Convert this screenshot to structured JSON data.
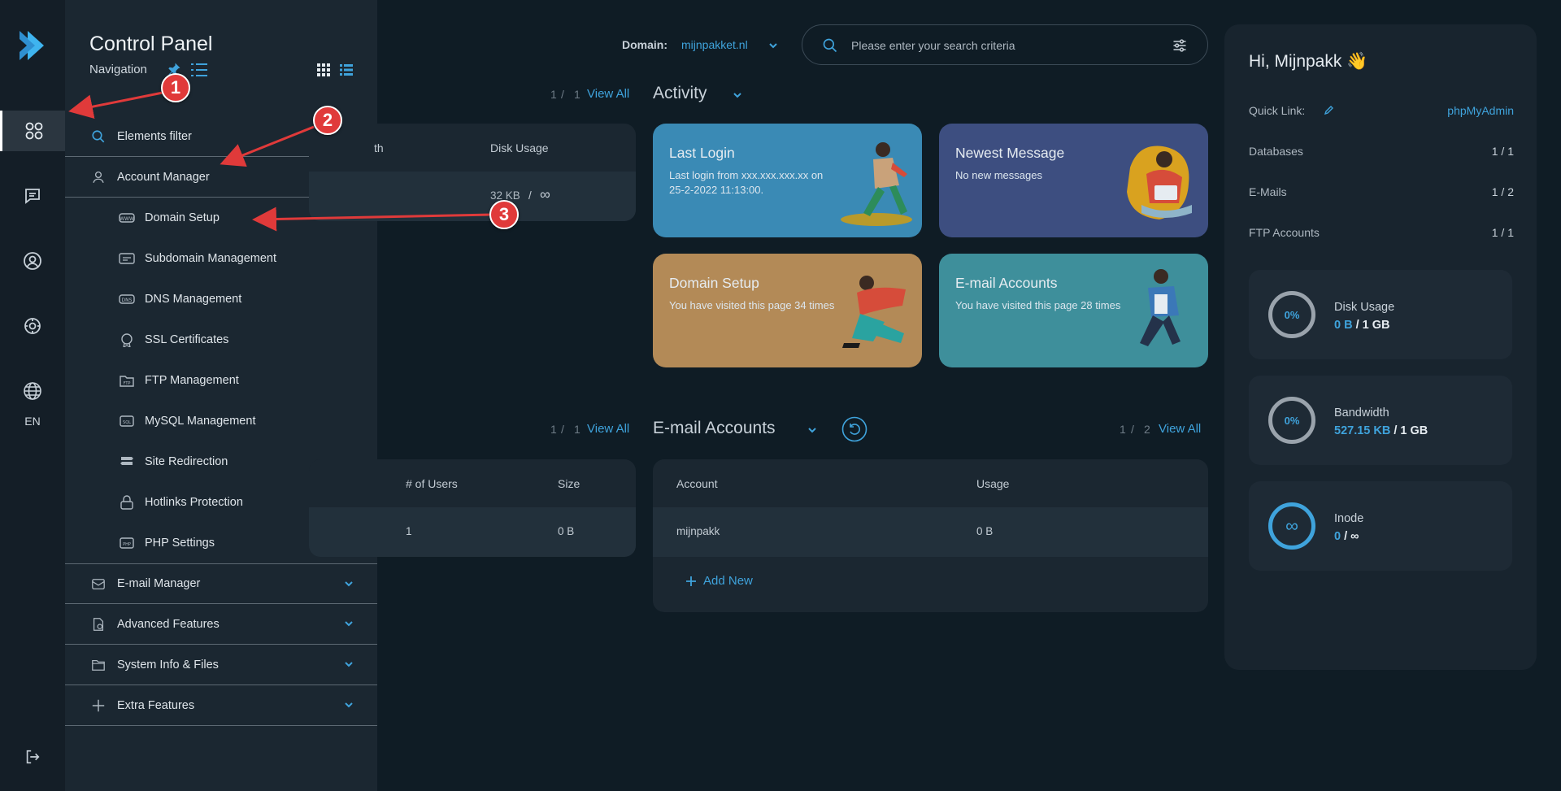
{
  "rail": {
    "lang": "EN"
  },
  "nav": {
    "title": "Control Panel",
    "subtitle": "Navigation",
    "filter_label": "Elements filter",
    "account_manager": "Account Manager",
    "items": [
      {
        "label": "Domain Setup",
        "icon": "www-icon"
      },
      {
        "label": "Subdomain Management",
        "icon": "subdomain-icon"
      },
      {
        "label": "DNS Management",
        "icon": "dns-icon"
      },
      {
        "label": "SSL Certificates",
        "icon": "ssl-icon"
      },
      {
        "label": "FTP Management",
        "icon": "ftp-icon"
      },
      {
        "label": "MySQL Management",
        "icon": "sql-icon"
      },
      {
        "label": "Site Redirection",
        "icon": "signpost-icon"
      },
      {
        "label": "Hotlinks Protection",
        "icon": "lock-icon"
      },
      {
        "label": "PHP Settings",
        "icon": "php-icon"
      }
    ],
    "sections": [
      {
        "label": "E-mail Manager",
        "icon": "mail-icon"
      },
      {
        "label": "Advanced Features",
        "icon": "advanced-icon"
      },
      {
        "label": "System Info & Files",
        "icon": "folder-icon"
      },
      {
        "label": "Extra Features",
        "icon": "plus-icon"
      }
    ]
  },
  "header": {
    "domain_label": "Domain:",
    "domain_value": "mijnpakket.nl",
    "search_placeholder": "Please enter your search criteria"
  },
  "domains_table": {
    "counter_a": "1",
    "sep": "/",
    "counter_b": "1",
    "view_all": "View All",
    "col_partial": "th",
    "col_disk": "Disk Usage",
    "disk_value": "32 KB",
    "disk_sep": "/",
    "disk_limit": "∞"
  },
  "activity": {
    "title": "Activity",
    "cards": [
      {
        "title": "Last Login",
        "text": "Last login from xxx.xxx.xxx.xx on 25-2-2022 11:13:00."
      },
      {
        "title": "Newest Message",
        "text": "No new messages"
      },
      {
        "title": "Domain Setup",
        "text": "You have visited this page 34 times"
      },
      {
        "title": "E-mail Accounts",
        "text": "You have visited this page 28 times"
      }
    ]
  },
  "ftp_table": {
    "counter_a": "1",
    "sep": "/",
    "counter_b": "1",
    "view_all": "View All",
    "col_users": "# of Users",
    "col_size": "Size",
    "users": "1",
    "size": "0 B"
  },
  "email_accounts": {
    "title": "E-mail Accounts",
    "counter_a": "1",
    "sep": "/",
    "counter_b": "2",
    "view_all": "View All",
    "col_account": "Account",
    "col_usage": "Usage",
    "account": "mijnpakk",
    "usage": "0 B",
    "add_new": "Add New"
  },
  "right": {
    "greeting": "Hi, Mijnpakk 👋",
    "quick_link_label": "Quick Link:",
    "quick_link_value": "phpMyAdmin",
    "rows": [
      {
        "label": "Databases",
        "value": "1 / 1"
      },
      {
        "label": "E-Mails",
        "value": "1 / 2"
      },
      {
        "label": "FTP Accounts",
        "value": "1 / 1"
      }
    ],
    "disk": {
      "label": "Disk Usage",
      "pct": "0%",
      "used": "0 B",
      "sep": "/",
      "total": "1 GB"
    },
    "bandwidth": {
      "label": "Bandwidth",
      "pct": "0%",
      "used": "527.15 KB",
      "sep": "/",
      "total": "1 GB"
    },
    "inode": {
      "label": "Inode",
      "ring": "∞",
      "used": "0",
      "sep": "/",
      "total": "∞"
    }
  },
  "callouts": [
    "1",
    "2",
    "3"
  ],
  "colors": {
    "accent": "#3fa3dc",
    "callout": "#e03a3a",
    "card_login": "#3a8ab5",
    "card_message": "#3d4e80",
    "card_domain": "#b38a57",
    "card_email": "#3e8f9b"
  }
}
